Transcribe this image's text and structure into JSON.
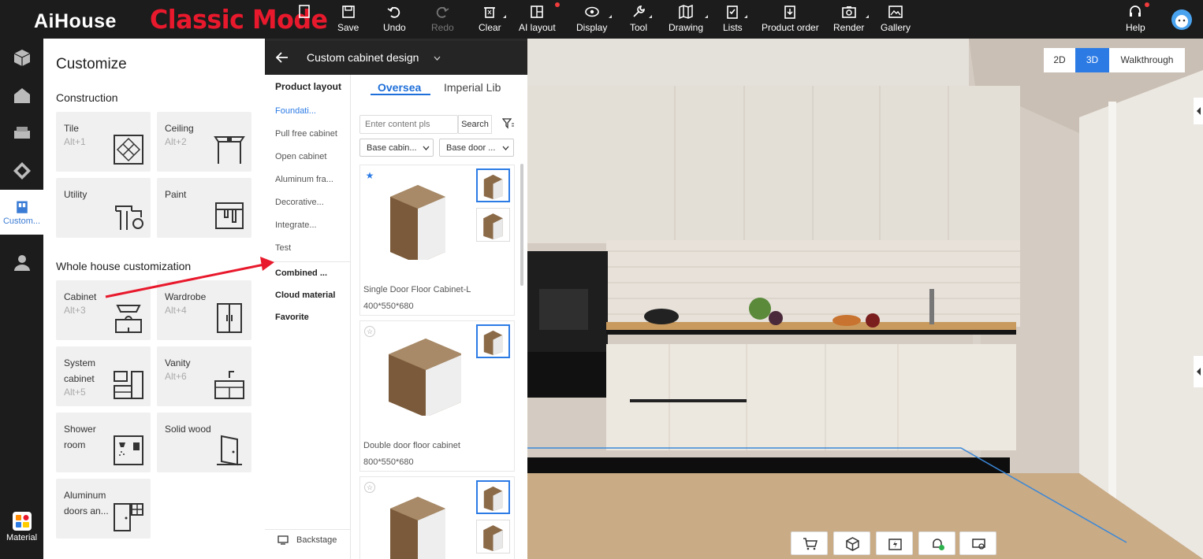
{
  "brand": {
    "name": "AiHouse",
    "mode_label": "Classic Mode"
  },
  "toolbar": [
    {
      "label": "Save",
      "icon": "save-icon"
    },
    {
      "label": "Undo",
      "icon": "undo-icon"
    },
    {
      "label": "Redo",
      "icon": "redo-icon",
      "disabled": true
    },
    {
      "label": "Clear",
      "icon": "clear-icon"
    },
    {
      "label": "AI layout",
      "icon": "ai-layout-icon",
      "badge": true
    },
    {
      "label": "Display",
      "icon": "eye-icon"
    },
    {
      "label": "Tool",
      "icon": "wrench-icon"
    },
    {
      "label": "Drawing",
      "icon": "map-icon"
    },
    {
      "label": "Lists",
      "icon": "checklist-icon"
    },
    {
      "label": "Product order",
      "icon": "order-icon"
    },
    {
      "label": "Render",
      "icon": "camera-icon"
    },
    {
      "label": "Gallery",
      "icon": "gallery-icon"
    },
    {
      "label": "Help",
      "icon": "headset-icon",
      "badge": true
    }
  ],
  "sidebar": {
    "items": [
      {
        "label": "",
        "icon": "box-icon"
      },
      {
        "label": "",
        "icon": "house-icon"
      },
      {
        "label": "",
        "icon": "sofa-icon"
      },
      {
        "label": "",
        "icon": "diamond-icon"
      },
      {
        "label": "Custom...",
        "icon": "customize-icon",
        "active": true
      },
      {
        "label": "",
        "icon": "user-icon"
      }
    ],
    "material_label": "Material"
  },
  "customize": {
    "title": "Customize",
    "construction_title": "Construction",
    "construction": [
      {
        "name": "Tile",
        "shortcut": "Alt+1"
      },
      {
        "name": "Ceiling",
        "shortcut": "Alt+2"
      },
      {
        "name": "Utility",
        "shortcut": ""
      },
      {
        "name": "Paint",
        "shortcut": ""
      }
    ],
    "whole_title": "Whole house customization",
    "whole": [
      {
        "name": "Cabinet",
        "shortcut": "Alt+3"
      },
      {
        "name": "Wardrobe",
        "shortcut": "Alt+4"
      },
      {
        "name": "System cabinet",
        "shortcut": "Alt+5"
      },
      {
        "name": "Vanity",
        "shortcut": "Alt+6"
      },
      {
        "name": "Shower room",
        "shortcut": ""
      },
      {
        "name": "Solid wood",
        "shortcut": ""
      },
      {
        "name": "Aluminum doors an...",
        "shortcut": ""
      }
    ]
  },
  "designer": {
    "title": "Custom cabinet design",
    "categories": [
      {
        "label": "Product layout",
        "bold": true
      },
      {
        "label": "Foundati...",
        "active": true
      },
      {
        "label": "Pull free cabinet"
      },
      {
        "label": "Open cabinet"
      },
      {
        "label": "Aluminum fra..."
      },
      {
        "label": "Decorative..."
      },
      {
        "label": "Integrate..."
      },
      {
        "label": "Test"
      },
      {
        "label": "Combined ...",
        "bold": true
      },
      {
        "label": "Cloud material",
        "bold": true
      },
      {
        "label": "Favorite",
        "bold": true
      }
    ],
    "backstage_label": "Backstage",
    "tabs": [
      "Oversea",
      "Imperial Lib"
    ],
    "search": {
      "placeholder": "Enter content pls",
      "button": "Search"
    },
    "filters": [
      "Base cabin...",
      "Base door ..."
    ],
    "products": [
      {
        "name": "Single Door Floor Cabinet-L",
        "size": "400*550*680",
        "favorite": true
      },
      {
        "name": "Double door floor cabinet",
        "size": "800*550*680",
        "favorite": false
      },
      {
        "name": "",
        "size": "",
        "favorite": false
      }
    ]
  },
  "scene": {
    "views": [
      "2D",
      "3D",
      "Walkthrough"
    ],
    "active_view": "3D",
    "bottom_tools": [
      "cart-icon",
      "cube-icon",
      "battery-icon",
      "bell-check-icon",
      "screen-settings-icon"
    ]
  },
  "colors": {
    "accent": "#2c7be5",
    "mode_red": "#e8192c",
    "topbar": "#1c1c1c"
  }
}
